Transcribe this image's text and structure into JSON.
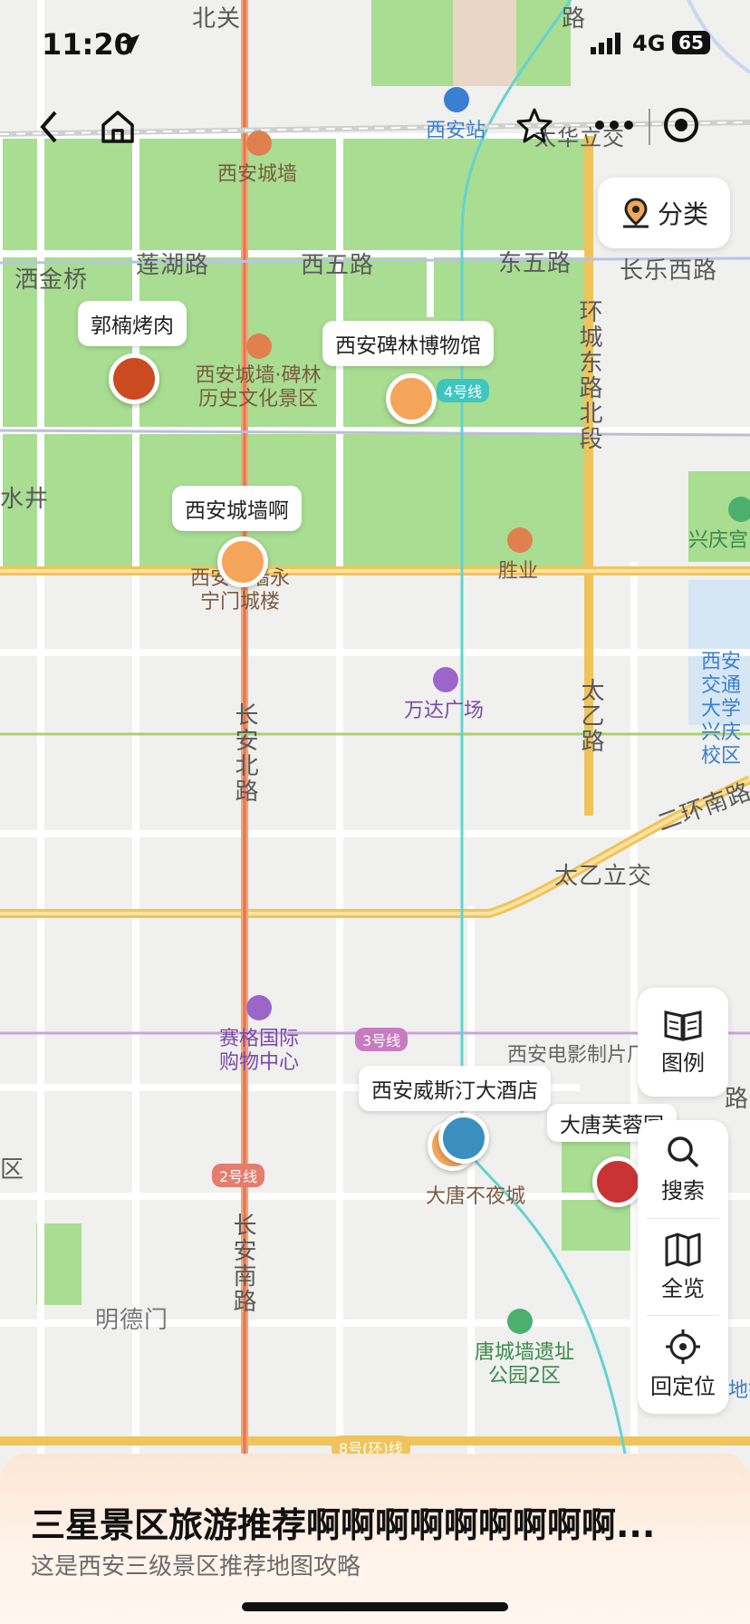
{
  "status_bar": {
    "time": "11:20",
    "network": "4G",
    "battery": "65"
  },
  "category_button": {
    "label": "分类"
  },
  "side_panel": {
    "legend": {
      "label": "图例",
      "icon": "book-icon"
    },
    "search": {
      "label": "搜索",
      "icon": "search-icon"
    },
    "overview": {
      "label": "全览",
      "icon": "map-icon"
    },
    "relocate": {
      "label": "回定位",
      "icon": "crosshair-icon"
    }
  },
  "map": {
    "roads": [
      "北关",
      "路",
      "莲湖路",
      "西五路",
      "东五路",
      "长乐西路",
      "洒金桥",
      "环城东路北段",
      "水井",
      "长安北路",
      "太乙路",
      "太乙立交",
      "二环南路",
      "长安南路",
      "明德门",
      "区",
      "路",
      "太华立交"
    ],
    "pois": [
      "西安城墙",
      "西安城墙·碑林历史文化景区",
      "胜业",
      "西安城墙永宁门城楼",
      "万达广场",
      "赛格国际购物中心",
      "西安电影制片厂",
      "大唐不夜城",
      "唐城墙遗址公园2区",
      "兴庆宫",
      "西安交通大学兴庆校区",
      "西安站",
      "地铁"
    ],
    "metro": [
      "4号线",
      "3号线",
      "2号线",
      "8号(环)线"
    ]
  },
  "markers": [
    {
      "name": "郭楠烤肉",
      "color": "#cc4a1f"
    },
    {
      "name": "西安碑林博物馆",
      "color": "#f4a55a"
    },
    {
      "name": "西安城墙啊",
      "color": "#f4a55a"
    },
    {
      "name": "西安威斯汀大酒店",
      "color": "#3a8fbf"
    },
    {
      "name": "大唐芙蓉园",
      "color": "#c93333"
    }
  ],
  "bottom_card": {
    "title": "三星景区旅游推荐啊啊啊啊啊啊啊啊啊...",
    "subtitle": "这是西安三级景区推荐地图攻略"
  }
}
